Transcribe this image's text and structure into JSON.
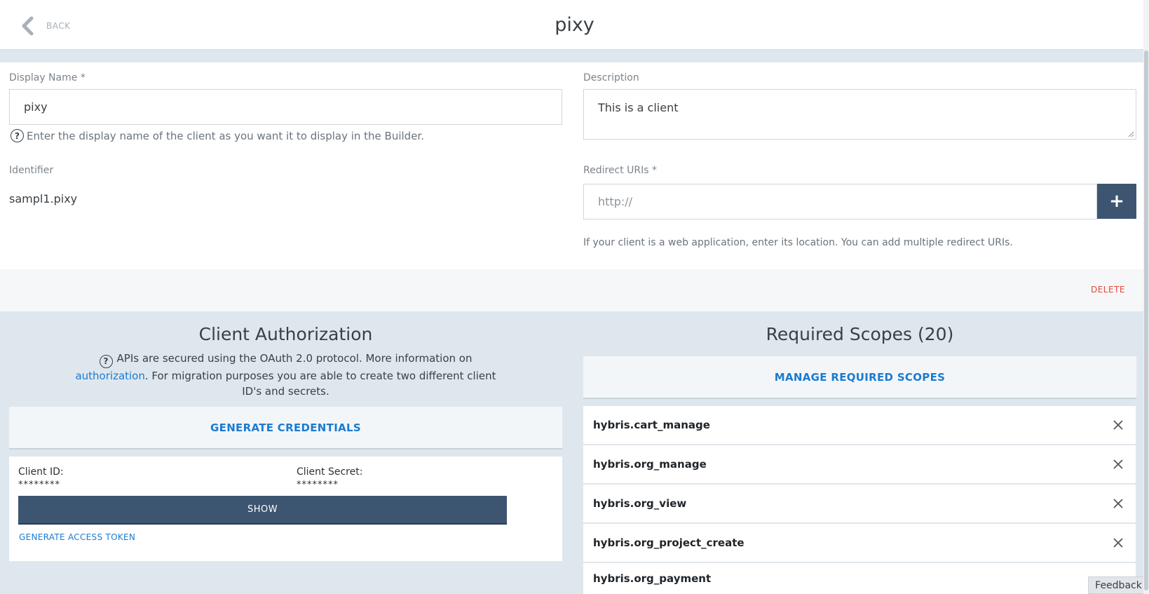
{
  "header": {
    "back_label": "BACK",
    "title": "pixy"
  },
  "form": {
    "display_name": {
      "label": "Display Name *",
      "value": "pixy",
      "help": "Enter the display name of the client as you want it to display in the Builder."
    },
    "description": {
      "label": "Description",
      "value": "This is a client"
    },
    "identifier": {
      "label": "Identifier",
      "value": "sampl1.pixy"
    },
    "redirect_uris": {
      "label": "Redirect URIs *",
      "placeholder": "http://",
      "add_label": "+",
      "help": "If your client is a web application, enter its location. You can add multiple redirect URIs."
    },
    "delete_label": "DELETE"
  },
  "client_authorization": {
    "title": "Client Authorization",
    "desc_before": "APIs are secured using the OAuth 2.0 protocol. More information on ",
    "desc_link": "authorization",
    "desc_after": ". For migration purposes you are able to create two different client ID's and secrets.",
    "generate_label": "GENERATE CREDENTIALS",
    "client_id_label": "Client ID:",
    "client_id_value": "********",
    "client_secret_label": "Client Secret:",
    "client_secret_value": "********",
    "show_label": "SHOW",
    "access_token_label": "GENERATE ACCESS TOKEN"
  },
  "required_scopes": {
    "title": "Required Scopes (20)",
    "manage_label": "MANAGE REQUIRED SCOPES",
    "items": [
      "hybris.cart_manage",
      "hybris.org_manage",
      "hybris.org_view",
      "hybris.org_project_create",
      "hybris.org_payment"
    ]
  },
  "feedback_label": "Feedback",
  "colors": {
    "accent": "#1a7bd1",
    "primary_button": "#3d5570",
    "danger": "#e5483c",
    "section_bg": "#dfe7ee"
  }
}
